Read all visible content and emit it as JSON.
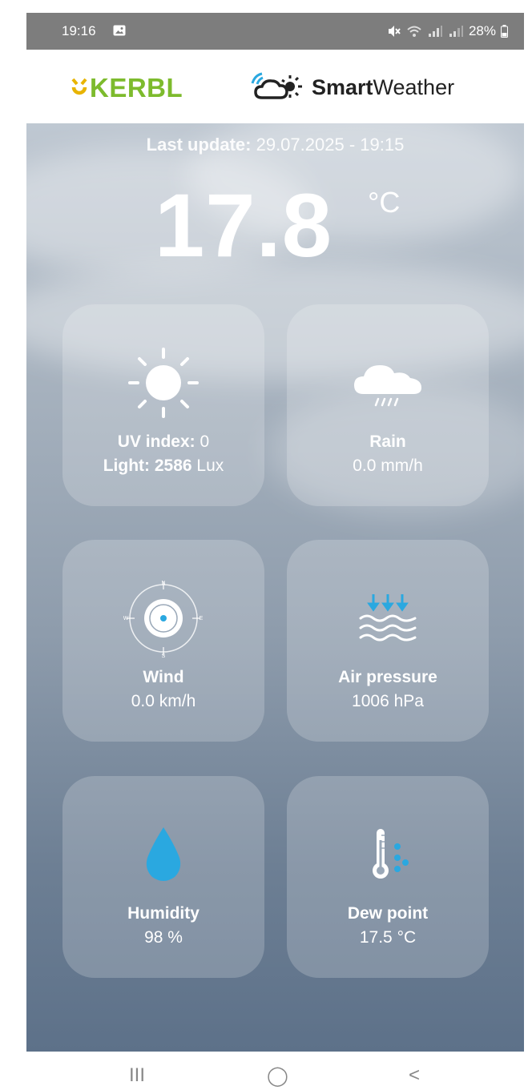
{
  "status_bar": {
    "time": "19:16",
    "battery": "28%",
    "icons": [
      "image-icon",
      "mute-icon",
      "wifi-icon",
      "signal-icon",
      "signal-icon",
      "battery-icon"
    ]
  },
  "header": {
    "brand": "KERBL",
    "app_name_bold": "Smart",
    "app_name_regular": "Weather",
    "brand_color": "#7dbb2d"
  },
  "weather": {
    "last_update_label": "Last update:",
    "last_update_value": "29.07.2025 - 19:15",
    "temperature": "17.8",
    "temperature_unit": "°C",
    "tiles": [
      {
        "id": "uv-light",
        "icon": "sun-icon",
        "line1_label": "UV index:",
        "line1_value": "0",
        "line2_label": "Light:",
        "line2_value": "2586",
        "line2_unit": "Lux"
      },
      {
        "id": "rain",
        "icon": "rain-cloud-icon",
        "label": "Rain",
        "value": "0.0 mm/h"
      },
      {
        "id": "wind",
        "icon": "compass-icon",
        "label": "Wind",
        "value": "0.0 km/h"
      },
      {
        "id": "air-pressure",
        "icon": "pressure-icon",
        "label": "Air pressure",
        "value": "1006 hPa"
      },
      {
        "id": "humidity",
        "icon": "water-drop-icon",
        "label": "Humidity",
        "value": "98 %"
      },
      {
        "id": "dew-point",
        "icon": "thermometer-drops-icon",
        "label": "Dew point",
        "value": "17.5 °C"
      }
    ],
    "accent_color": "#2aa8e0"
  },
  "nav_bar": {
    "recents": "III",
    "home": "◯",
    "back": "<"
  }
}
